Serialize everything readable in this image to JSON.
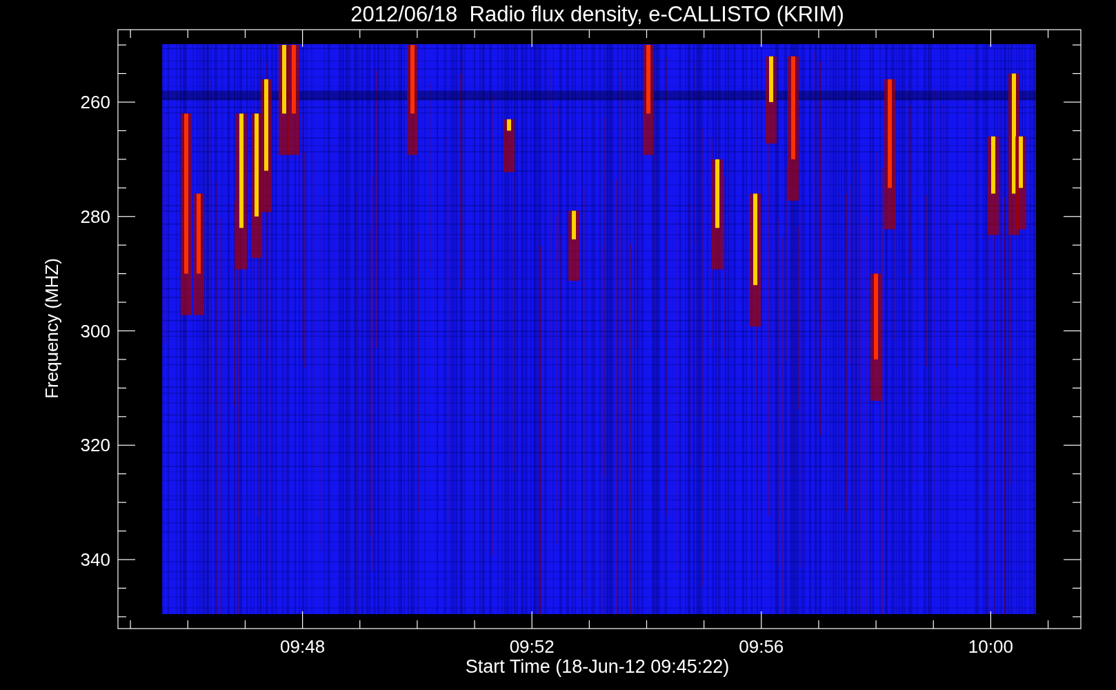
{
  "title": "2012/06/18  Radio flux density, e-CALLISTO (KRIM)",
  "y_axis": {
    "label": "Frequency (MHZ)",
    "tick_labels": [
      "260",
      "280",
      "300",
      "320",
      "340"
    ]
  },
  "x_axis": {
    "label": "Start Time (18-Jun-12 09:45:22)",
    "tick_labels": [
      "09:48",
      "09:52",
      "09:56",
      "10:00"
    ]
  }
}
